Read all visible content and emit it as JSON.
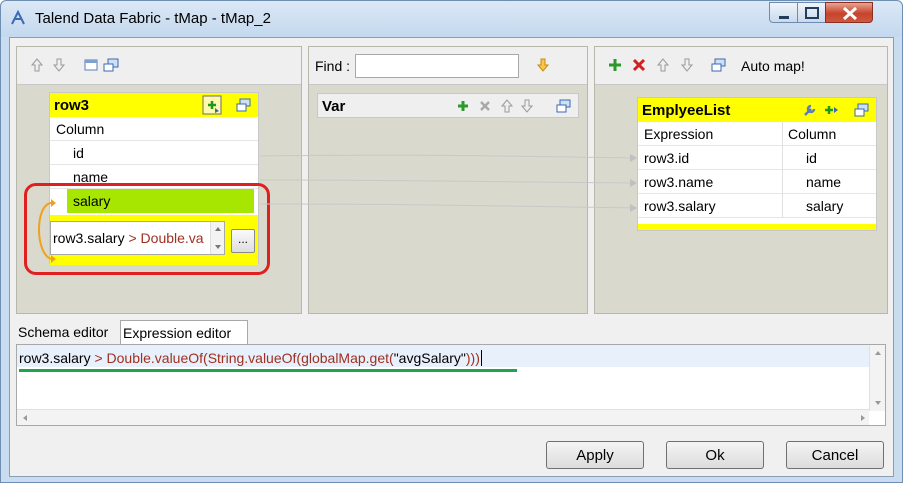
{
  "window": {
    "title": "Talend Data Fabric - tMap - tMap_2"
  },
  "find": {
    "label": "Find :",
    "value": ""
  },
  "input_table": {
    "title": "row3",
    "column_header": "Column",
    "rows": [
      "id",
      "name",
      "salary"
    ],
    "filter_expression": {
      "left": "row3.salary",
      "right": "> Double.va"
    },
    "browse_button": "..."
  },
  "var_table": {
    "title": "Var"
  },
  "output_toolbar": {
    "auto_map_label": "Auto map!"
  },
  "output_table": {
    "title": "EmplyeeList",
    "expression_header": "Expression",
    "column_header": "Column",
    "rows": [
      {
        "expression": "row3.id",
        "column": "id"
      },
      {
        "expression": "row3.name",
        "column": "name"
      },
      {
        "expression": "row3.salary",
        "column": "salary"
      }
    ]
  },
  "tabs": [
    {
      "label": "Schema editor",
      "active": false
    },
    {
      "label": "Expression editor",
      "active": true
    }
  ],
  "expression_editor": {
    "part1": "row3.salary ",
    "part2": "> Double.valueOf(String.valueOf(globalMap.get(",
    "part3": "\"avgSalary\"",
    "part4": ")))"
  },
  "buttons": {
    "apply": "Apply",
    "ok": "Ok",
    "cancel": "Cancel"
  },
  "colors": {
    "header_yellow": "#ffff00",
    "selected_row": "#a6e600",
    "highlight_red": "#e02020",
    "underline_green": "#1fa550"
  }
}
